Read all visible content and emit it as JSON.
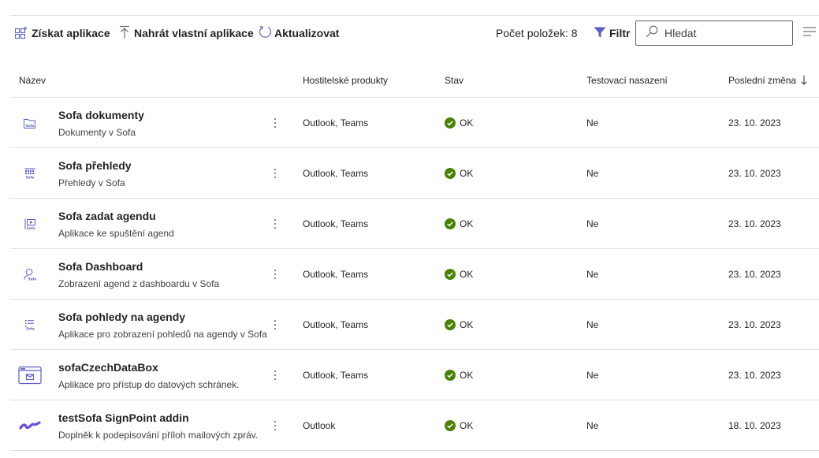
{
  "toolbar": {
    "get_apps_label": "Získat aplikace",
    "upload_label": "Nahrát vlastní aplikace",
    "refresh_label": "Aktualizovat",
    "count_label": "Počet položek: 8",
    "filter_label": "Filtr",
    "search_placeholder": "Hledat"
  },
  "table": {
    "headers": {
      "name": "Název",
      "hosts": "Hostitelské produkty",
      "status": "Stav",
      "test": "Testovací nasazení",
      "modified": "Poslední změna"
    },
    "rows": [
      {
        "icon": "folder-sofa-icon",
        "title": "Sofa dokumenty",
        "subtitle": "Dokumenty v Sofa",
        "hosts": "Outlook, Teams",
        "status": "OK",
        "test": "Ne",
        "modified": "23. 10. 2023"
      },
      {
        "icon": "grid-sofa-icon",
        "title": "Sofa přehledy",
        "subtitle": "Přehledy v Sofa",
        "hosts": "Outlook, Teams",
        "status": "OK",
        "test": "Ne",
        "modified": "23. 10. 2023"
      },
      {
        "icon": "play-sofa-icon",
        "title": "Sofa zadat agendu",
        "subtitle": "Aplikace ke spuštění agend",
        "hosts": "Outlook, Teams",
        "status": "OK",
        "test": "Ne",
        "modified": "23. 10. 2023"
      },
      {
        "icon": "person-sofa-icon",
        "title": "Sofa Dashboard",
        "subtitle": "Zobrazení agend z dashboardu v Sofa",
        "hosts": "Outlook, Teams",
        "status": "OK",
        "test": "Ne",
        "modified": "23. 10. 2023"
      },
      {
        "icon": "list-sofa-icon",
        "title": "Sofa pohledy na agendy",
        "subtitle": "Aplikace pro zobrazení pohledů na agendy v Sofa",
        "hosts": "Outlook, Teams",
        "status": "OK",
        "test": "Ne",
        "modified": "23. 10. 2023"
      },
      {
        "icon": "databox-window-icon",
        "title": "sofaCzechDataBox",
        "subtitle": "Aplikace pro přístup do datových schránek.",
        "hosts": "Outlook, Teams",
        "status": "OK",
        "test": "Ne",
        "modified": "23. 10. 2023"
      },
      {
        "icon": "signpoint-swoosh-icon",
        "title": "testSofa SignPoint addin",
        "subtitle": "Doplněk k podepisování příloh mailových zpráv.",
        "hosts": "Outlook",
        "status": "OK",
        "test": "Ne",
        "modified": "18. 10. 2023"
      }
    ]
  },
  "colors": {
    "accent": "#5b5fc7",
    "ok": "#498205",
    "text": "#242424",
    "divider": "#e0e0e0"
  }
}
